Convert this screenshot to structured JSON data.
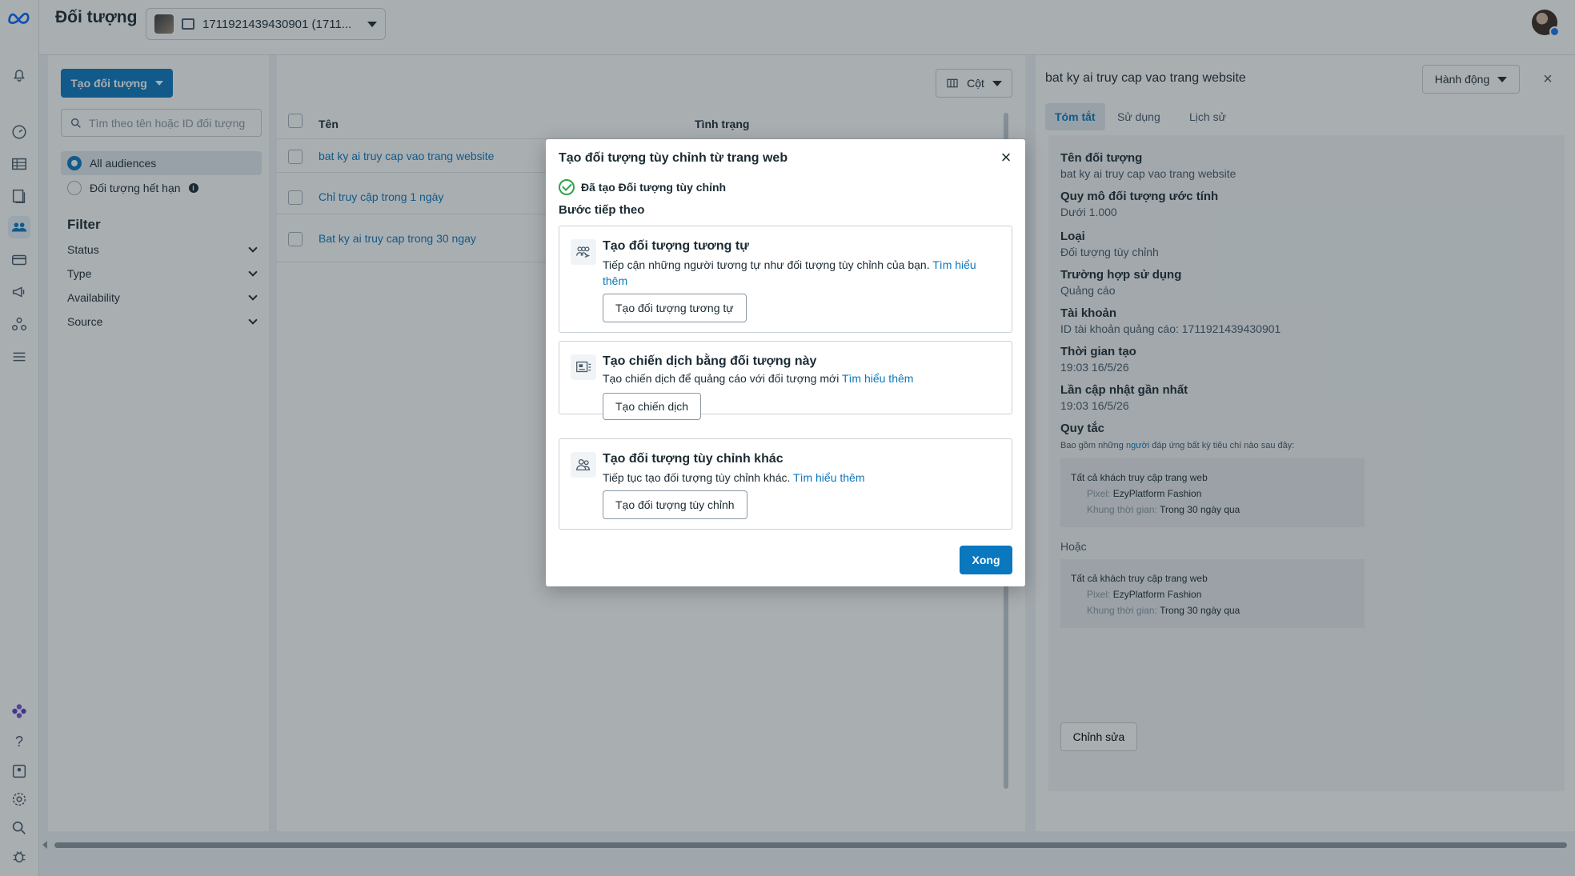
{
  "header": {
    "title": "Đối tượng",
    "account": "1711921439430901 (1711..."
  },
  "left_panel": {
    "create_button": "Tạo đối tượng",
    "search_placeholder": "Tìm theo tên hoặc ID đối tượng",
    "radios": [
      {
        "label": "All audiences",
        "selected": true
      },
      {
        "label": "Đối tượng hết hạn",
        "selected": false
      }
    ],
    "filter_heading": "Filter",
    "filters": [
      "Status",
      "Type",
      "Availability",
      "Source"
    ]
  },
  "table": {
    "columns_button": "Cột",
    "headers": {
      "name": "Tên",
      "status": "Tình trạng"
    },
    "rows": [
      {
        "name": "bat ky ai truy cap vao trang website"
      },
      {
        "name": "Chỉ truy cập trong 1 ngày"
      },
      {
        "name": "Bat ky ai truy cap trong 30 ngay"
      }
    ]
  },
  "detail": {
    "title": "bat ky ai truy cap vao trang website",
    "actions_button": "Hành động",
    "tabs": [
      "Tóm tắt",
      "Sử dụng",
      "Lịch sử"
    ],
    "active_tab": "Tóm tắt",
    "fields": [
      {
        "label": "Tên đối tượng",
        "value": "bat ky ai truy cap vao trang website"
      },
      {
        "label": "Quy mô đối tượng ước tính",
        "value": "Dưới 1.000"
      },
      {
        "label": "Loại",
        "value": "Đối tượng tùy chỉnh"
      },
      {
        "label": "Trường hợp sử dụng",
        "value": "Quảng cáo"
      },
      {
        "label": "Tài khoản",
        "value": "ID tài khoản quảng cáo: 1711921439430901"
      },
      {
        "label": "Thời gian tạo",
        "value": "19:03 16/5/26"
      },
      {
        "label": "Lần cập nhật gần nhất",
        "value": "19:03 16/5/26"
      }
    ],
    "rules_label": "Quy tắc",
    "rules_note_prefix": "Bao gồm những ",
    "rules_note_link": "người",
    "rules_note_suffix": " đáp ứng bất kỳ tiêu chí nào sau đây:",
    "rules": [
      {
        "title": "Tất cả khách truy cập trang web",
        "pixel_label": "Pixel:",
        "pixel": "EzyPlatform Fashion",
        "window_label": "Khung thời gian:",
        "window": "Trong 30 ngày qua"
      },
      {
        "title": "Tất cả khách truy cập trang web",
        "pixel_label": "Pixel:",
        "pixel": "EzyPlatform Fashion",
        "window_label": "Khung thời gian:",
        "window": "Trong 30 ngày qua"
      }
    ],
    "or_label": "Hoặc",
    "edit_button": "Chỉnh sửa"
  },
  "modal": {
    "title": "Tạo đối tượng tùy chỉnh từ trang web",
    "success": "Đã tạo Đối tượng tùy chỉnh",
    "next_steps": "Bước tiếp theo",
    "cards": [
      {
        "icon": "lookalike-people-icon",
        "title": "Tạo đối tượng tương tự",
        "desc": "Tiếp cận những người tương tự như đối tượng tùy chỉnh của bạn.",
        "link": "Tìm hiểu thêm",
        "button": "Tạo đối tượng tương tự"
      },
      {
        "icon": "campaign-icon",
        "title": "Tạo chiến dịch bằng đối tượng này",
        "desc": "Tạo chiến dịch để quảng cáo với đối tượng mới",
        "link": "Tìm hiểu thêm",
        "button": "Tạo chiến dịch"
      },
      {
        "icon": "people-icon",
        "title": "Tạo đối tượng tùy chỉnh khác",
        "desc": "Tiếp tục tạo đối tượng tùy chỉnh khác.",
        "link": "Tìm hiểu thêm",
        "button": "Tạo đối tượng tùy chỉnh"
      }
    ],
    "done_button": "Xong"
  },
  "colors": {
    "primary": "#0a78be",
    "success": "#31a24c",
    "overlay": "rgba(28,43,51,0.38)"
  }
}
